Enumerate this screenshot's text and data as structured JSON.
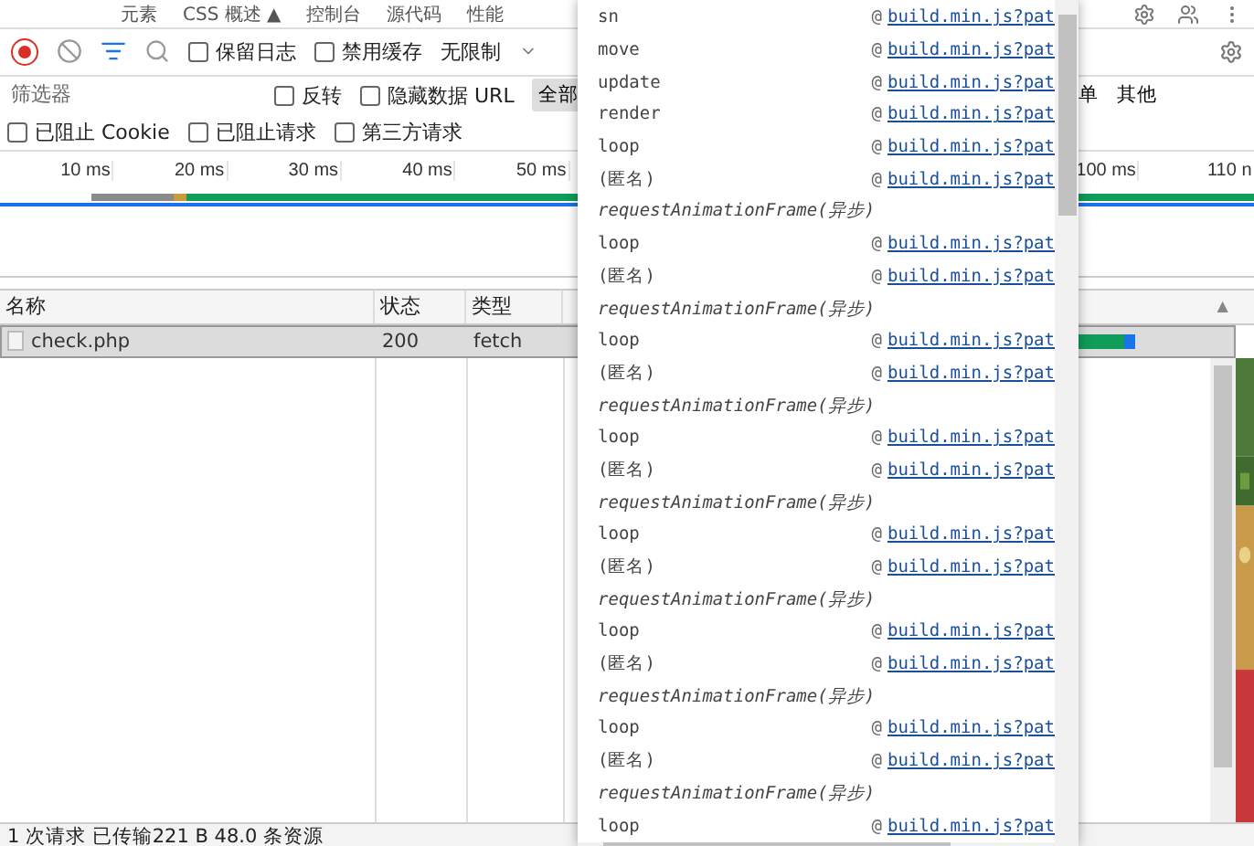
{
  "tabs": [
    {
      "label": "元素",
      "selected": false
    },
    {
      "label": "CSS 概述 ▲",
      "selected": false
    },
    {
      "label": "控制台",
      "selected": false
    },
    {
      "label": "源代码",
      "selected": false
    },
    {
      "label": "性能",
      "selected": false
    }
  ],
  "toolbar": {
    "recording": true,
    "options": [
      {
        "label": "保留日志",
        "checked": false
      },
      {
        "label": "禁用缓存",
        "checked": false
      }
    ],
    "throttle": "无限制"
  },
  "filter": {
    "placeholder": "筛选器",
    "options": [
      {
        "label": "反转",
        "checked": false
      },
      {
        "label": "隐藏数据 URL",
        "checked": false
      }
    ],
    "types": [
      {
        "label": "全部",
        "selected": true
      },
      {
        "label": "单",
        "selected": false
      },
      {
        "label": "其他",
        "selected": false
      }
    ]
  },
  "blocked": [
    {
      "label": "已阻止 Cookie",
      "checked": false
    },
    {
      "label": "已阻止请求",
      "checked": false
    },
    {
      "label": "第三方请求",
      "checked": false
    }
  ],
  "timeline": {
    "ticks": [
      "10 ms",
      "20 ms",
      "30 ms",
      "40 ms",
      "50 ms",
      "100 ms",
      "110 n"
    ]
  },
  "table": {
    "columns": [
      "名称",
      "状态",
      "类型"
    ],
    "sort_indicator": "▲",
    "rows": [
      {
        "cells": [
          "check.php",
          "200",
          "fetch"
        ],
        "selected": true
      }
    ]
  },
  "status_bar": "1 次请求 已传输221 B 48.0 条资源",
  "stack": [
    {
      "kind": "frame",
      "fn": "sn",
      "at": "@",
      "source": "build.min.js?pat"
    },
    {
      "kind": "frame",
      "fn": "move",
      "at": "@",
      "source": "build.min.js?pat"
    },
    {
      "kind": "frame",
      "fn": "update",
      "at": "@",
      "source": "build.min.js?pat"
    },
    {
      "kind": "frame",
      "fn": "render",
      "at": "@",
      "source": "build.min.js?pat"
    },
    {
      "kind": "frame",
      "fn": "loop",
      "at": "@",
      "source": "build.min.js?pat"
    },
    {
      "kind": "frame",
      "fn": "(匿名)",
      "at": "@",
      "source": "build.min.js?pat"
    },
    {
      "kind": "async",
      "label": "requestAnimationFrame(异步)"
    },
    {
      "kind": "frame",
      "fn": "loop",
      "at": "@",
      "source": "build.min.js?pat"
    },
    {
      "kind": "frame",
      "fn": "(匿名)",
      "at": "@",
      "source": "build.min.js?pat"
    },
    {
      "kind": "async",
      "label": "requestAnimationFrame(异步)"
    },
    {
      "kind": "frame",
      "fn": "loop",
      "at": "@",
      "source": "build.min.js?pat"
    },
    {
      "kind": "frame",
      "fn": "(匿名)",
      "at": "@",
      "source": "build.min.js?pat"
    },
    {
      "kind": "async",
      "label": "requestAnimationFrame(异步)"
    },
    {
      "kind": "frame",
      "fn": "loop",
      "at": "@",
      "source": "build.min.js?pat"
    },
    {
      "kind": "frame",
      "fn": "(匿名)",
      "at": "@",
      "source": "build.min.js?pat"
    },
    {
      "kind": "async",
      "label": "requestAnimationFrame(异步)"
    },
    {
      "kind": "frame",
      "fn": "loop",
      "at": "@",
      "source": "build.min.js?pat"
    },
    {
      "kind": "frame",
      "fn": "(匿名)",
      "at": "@",
      "source": "build.min.js?pat"
    },
    {
      "kind": "async",
      "label": "requestAnimationFrame(异步)"
    },
    {
      "kind": "frame",
      "fn": "loop",
      "at": "@",
      "source": "build.min.js?pat"
    },
    {
      "kind": "frame",
      "fn": "(匿名)",
      "at": "@",
      "source": "build.min.js?pat"
    },
    {
      "kind": "async",
      "label": "requestAnimationFrame(异步)"
    },
    {
      "kind": "frame",
      "fn": "loop",
      "at": "@",
      "source": "build.min.js?pat"
    },
    {
      "kind": "frame",
      "fn": "(匿名)",
      "at": "@",
      "source": "build.min.js?pat"
    },
    {
      "kind": "async",
      "label": "requestAnimationFrame(异步)"
    },
    {
      "kind": "frame",
      "fn": "loop",
      "at": "@",
      "source": "build.min.js?pat"
    }
  ]
}
